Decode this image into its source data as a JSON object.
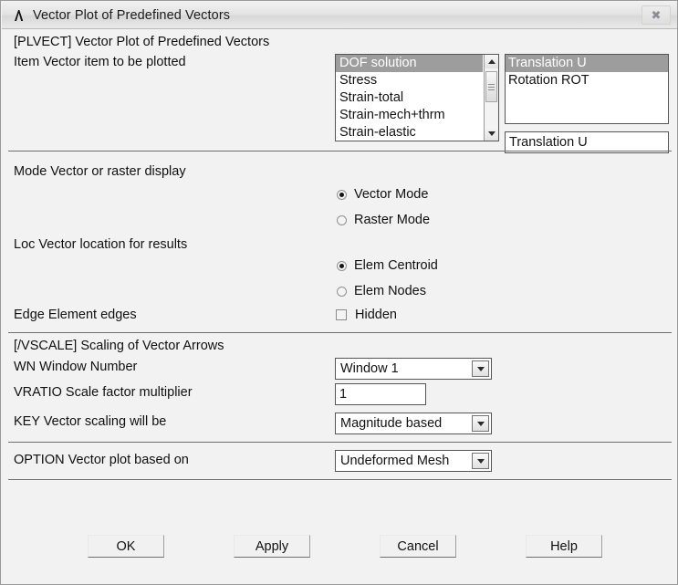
{
  "window": {
    "title": "Vector Plot of Predefined Vectors",
    "app_icon": "ansys-logo-icon",
    "close_label": "✖"
  },
  "header": {
    "command": "[PLVECT]  Vector Plot of Predefined Vectors",
    "item_label": "Item  Vector item to be plotted"
  },
  "item_list": {
    "options": [
      "DOF solution",
      "Stress",
      "Strain-total",
      "Strain-mech+thrm",
      "Strain-elastic"
    ],
    "selected_index": 0
  },
  "component_list": {
    "options": [
      "Translation    U",
      "Rotation     ROT"
    ],
    "selected_index": 0
  },
  "component_field": {
    "value": "Translation    U"
  },
  "mode_section": {
    "label": "Mode  Vector or raster display",
    "options": [
      {
        "label": "Vector Mode",
        "selected": true
      },
      {
        "label": "Raster Mode",
        "selected": false
      }
    ]
  },
  "loc_section": {
    "label": "Loc  Vector location for results",
    "options": [
      {
        "label": "Elem Centroid",
        "selected": true
      },
      {
        "label": "Elem Nodes",
        "selected": false
      }
    ]
  },
  "edge_section": {
    "label": "Edge Element edges",
    "checkbox_label": "Hidden",
    "checked": false
  },
  "vscale_section": {
    "command": "[/VSCALE] Scaling of Vector Arrows",
    "wn_label": "WN  Window Number",
    "wn_value": "Window 1",
    "vratio_label": "VRATIO  Scale factor multiplier",
    "vratio_value": "1",
    "key_label": "KEY     Vector scaling will be",
    "key_value": "Magnitude based"
  },
  "option_section": {
    "label": "OPTION  Vector plot based on",
    "value": "Undeformed Mesh"
  },
  "buttons": {
    "ok": "OK",
    "apply": "Apply",
    "cancel": "Cancel",
    "help": "Help"
  }
}
